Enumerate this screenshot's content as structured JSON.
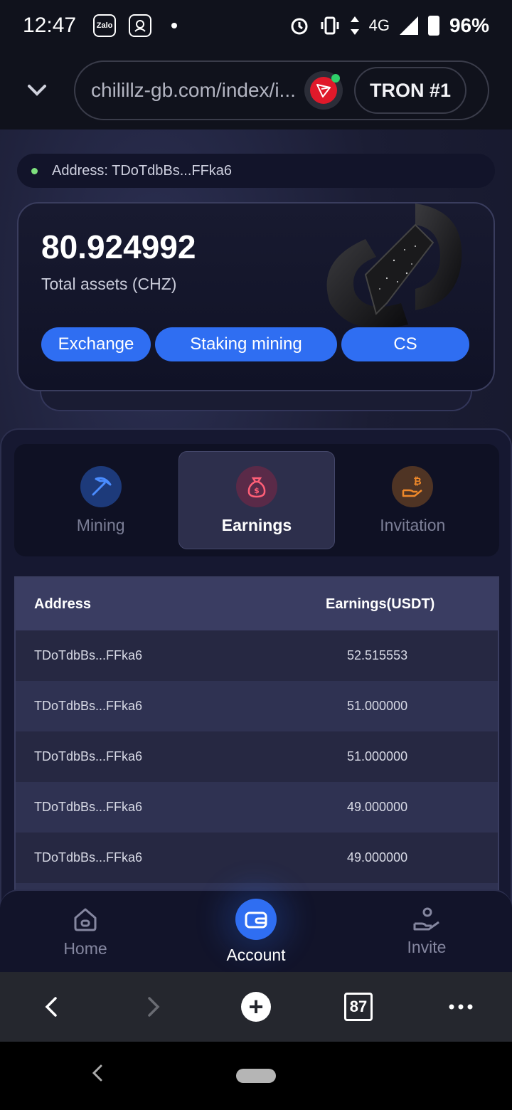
{
  "status_bar": {
    "time": "12:47",
    "apps": [
      "Zalo"
    ],
    "network": "4G",
    "battery": "96%"
  },
  "browser": {
    "url": "chilillz-gb.com/index/i...",
    "wallet_label": "TRON #1"
  },
  "account": {
    "address_label": "Address: TDoTdbBs...FFka6",
    "total_value": "80.924992",
    "total_label": "Total assets (CHZ)",
    "buttons": [
      "Exchange",
      "Staking mining",
      "CS"
    ]
  },
  "tabs": [
    {
      "label": "Mining",
      "icon": "pickaxe-icon",
      "color": "#2f6ef2"
    },
    {
      "label": "Earnings",
      "icon": "money-bag-icon",
      "color": "#e5415b"
    },
    {
      "label": "Invitation",
      "icon": "bitcoin-hand-icon",
      "color": "#f0892a"
    }
  ],
  "earnings_table": {
    "headers": [
      "Address",
      "Earnings(USDT)"
    ],
    "rows": [
      [
        "TDoTdbBs...FFka6",
        "52.515553"
      ],
      [
        "TDoTdbBs...FFka6",
        "51.000000"
      ],
      [
        "TDoTdbBs...FFka6",
        "51.000000"
      ],
      [
        "TDoTdbBs...FFka6",
        "49.000000"
      ],
      [
        "TDoTdbBs...FFka6",
        "49.000000"
      ]
    ]
  },
  "app_nav": [
    "Home",
    "Account",
    "Invite"
  ],
  "toolbar": {
    "tab_count": "87"
  }
}
